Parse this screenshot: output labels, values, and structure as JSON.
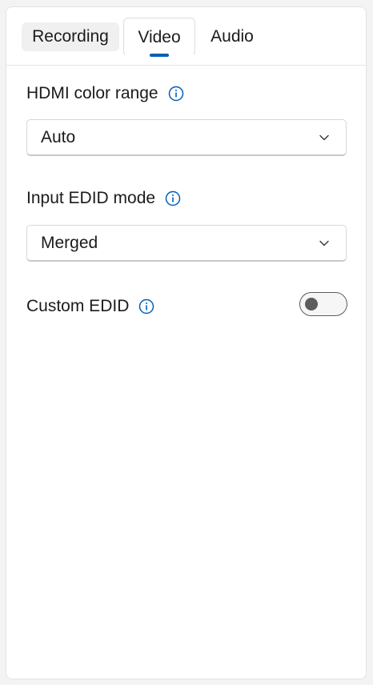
{
  "tabs": [
    {
      "label": "Recording",
      "selected": false
    },
    {
      "label": "Video",
      "selected": true
    },
    {
      "label": "Audio",
      "selected": false
    }
  ],
  "settings": {
    "hdmi_color_range": {
      "label": "HDMI color range",
      "value": "Auto"
    },
    "input_edid_mode": {
      "label": "Input EDID mode",
      "value": "Merged"
    },
    "custom_edid": {
      "label": "Custom EDID",
      "enabled": false
    }
  },
  "icons": {
    "info": "info-icon",
    "dropdown": "chevron-down-icon"
  },
  "colors": {
    "accent": "#005fb8",
    "toggle_off": "#5d5d5d",
    "background": "#f3f3f3",
    "panel": "#ffffff"
  }
}
